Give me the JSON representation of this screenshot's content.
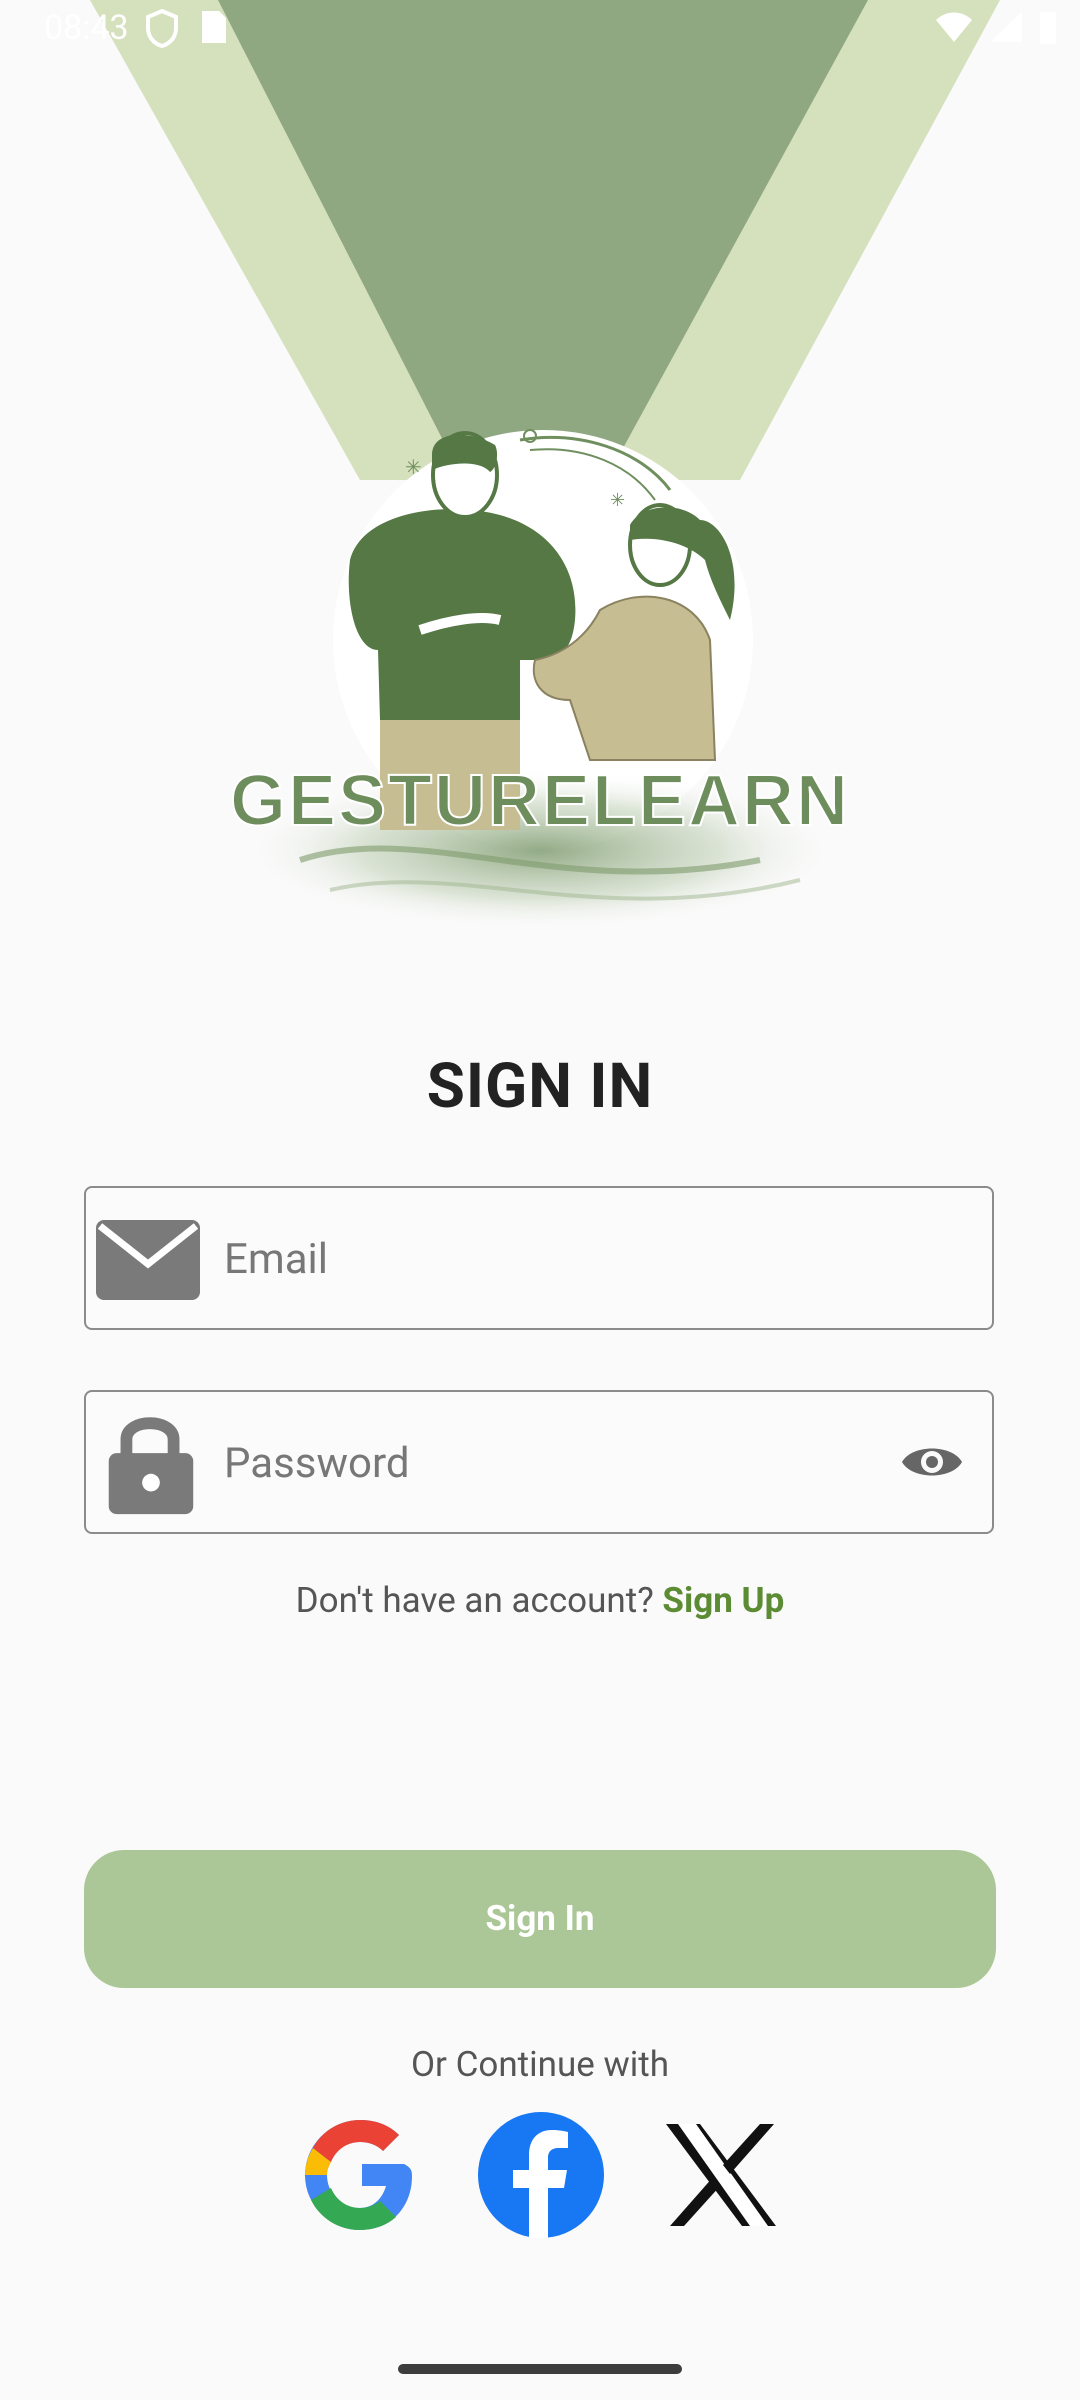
{
  "status_bar": {
    "time": "08:43",
    "left_icons": [
      "shield-icon",
      "sim-card-icon"
    ],
    "right_icons": [
      "wifi-icon",
      "signal-icon",
      "battery-icon"
    ]
  },
  "hero": {
    "logo_text": "GESTURELEARN",
    "icon": "sign-language-people-illustration"
  },
  "title": "SIGN IN",
  "email": {
    "placeholder": "Email",
    "value": "",
    "icon": "mail-icon"
  },
  "password": {
    "placeholder": "Password",
    "value": "",
    "icon": "lock-icon",
    "toggle_icon": "eye-icon"
  },
  "signup_prompt": {
    "text": "Don't have an account? ",
    "link": "Sign Up"
  },
  "signin_button": "Sign In",
  "or_continue": "Or Continue with",
  "social": [
    "google-icon",
    "facebook-icon",
    "x-icon"
  ],
  "colors": {
    "accent": "#5b8b33",
    "button": "#abc797",
    "background": "#fafafa",
    "beam_dark": "#8fa882",
    "beam_light": "#d5e0bd",
    "figure_green": "#557845",
    "figure_tan": "#c7bd92"
  }
}
